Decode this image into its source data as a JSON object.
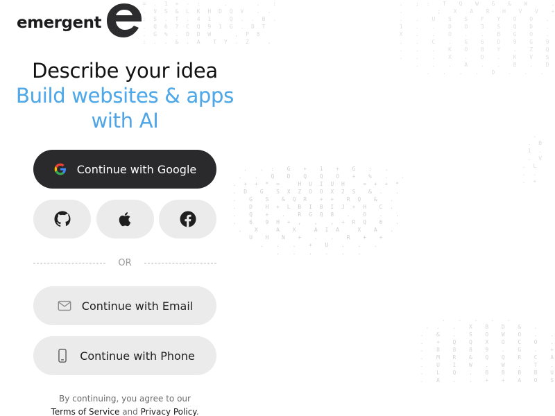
{
  "brand": {
    "wordmark": "emergent",
    "logo_icon": "emergent-e-logo"
  },
  "headline": {
    "line1": "Describe your idea",
    "line2": "Build websites & apps",
    "line3": "with AI",
    "accent_color": "#4fa8e8"
  },
  "auth": {
    "google_label": "Continue with Google",
    "google_icon": "google-icon",
    "github_icon": "github-icon",
    "apple_icon": "apple-icon",
    "facebook_icon": "facebook-icon",
    "divider_label": "OR",
    "email_label": "Continue with Email",
    "email_icon": "envelope-icon",
    "phone_label": "Continue with Phone",
    "phone_icon": "phone-icon"
  },
  "legal": {
    "prefix": "By continuing, you agree to our",
    "terms_link": "Terms of Service",
    "and": "and",
    "privacy_link": "Privacy Policy",
    "suffix": "."
  },
  "colors": {
    "primary_button": "#2a2a2c",
    "secondary_button": "#ebebeb",
    "background": "#ffffff"
  }
}
